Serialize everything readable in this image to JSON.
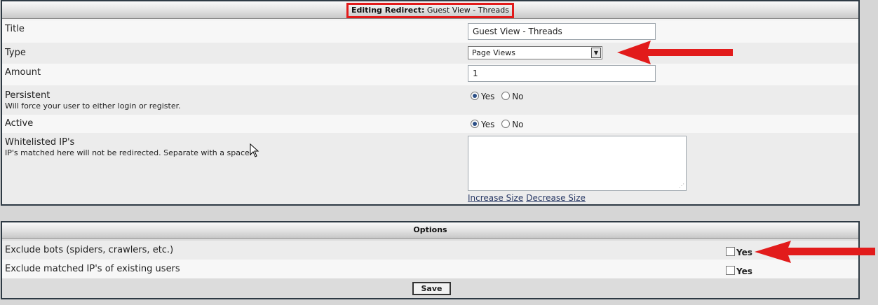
{
  "editing_panel": {
    "header_label": "Editing Redirect:",
    "header_value": "Guest View - Threads",
    "title_label": "Title",
    "title_value": "Guest View - Threads",
    "type_label": "Type",
    "type_value": "Page Views",
    "amount_label": "Amount",
    "amount_value": "1",
    "persistent_label": "Persistent",
    "persistent_desc": "Will force your user to either login or register.",
    "persistent_yes": "Yes",
    "persistent_no": "No",
    "active_label": "Active",
    "active_yes": "Yes",
    "active_no": "No",
    "whitelist_label": "Whitelisted IP's",
    "whitelist_desc": "IP's matched here will not be redirected. Separate with a space.",
    "increase_size": "Increase Size",
    "decrease_size": "Decrease Size"
  },
  "options_panel": {
    "header": "Options",
    "exclude_bots_label": "Exclude bots (spiders, crawlers, etc.)",
    "exclude_bots_check": "Yes",
    "exclude_ips_label": "Exclude matched IP's of existing users",
    "exclude_ips_check": "Yes",
    "save_label": "Save"
  },
  "colors": {
    "annotation_red": "#e21b1b",
    "panel_border": "#2e3a44"
  }
}
